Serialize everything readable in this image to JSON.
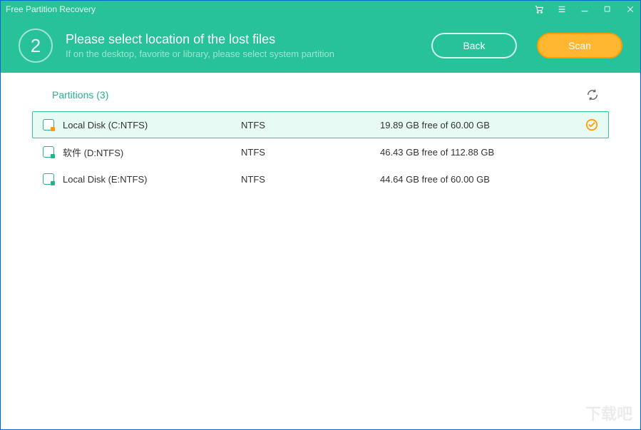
{
  "titlebar": {
    "title": "Free Partition Recovery"
  },
  "header": {
    "step_number": "2",
    "heading": "Please select location of the lost files",
    "subheading": "If on the desktop, favorite or library, please select system partition",
    "back_label": "Back",
    "scan_label": "Scan"
  },
  "partitions": {
    "label": "Partitions (3)",
    "rows": [
      {
        "name": "Local Disk (C:NTFS)",
        "fs": "NTFS",
        "free": "19.89 GB free of 60.00 GB",
        "selected": true
      },
      {
        "name": "软件 (D:NTFS)",
        "fs": "NTFS",
        "free": "46.43 GB free of 112.88 GB",
        "selected": false
      },
      {
        "name": "Local Disk (E:NTFS)",
        "fs": "NTFS",
        "free": "44.64 GB free of 60.00 GB",
        "selected": false
      }
    ]
  },
  "watermark": "下载吧"
}
